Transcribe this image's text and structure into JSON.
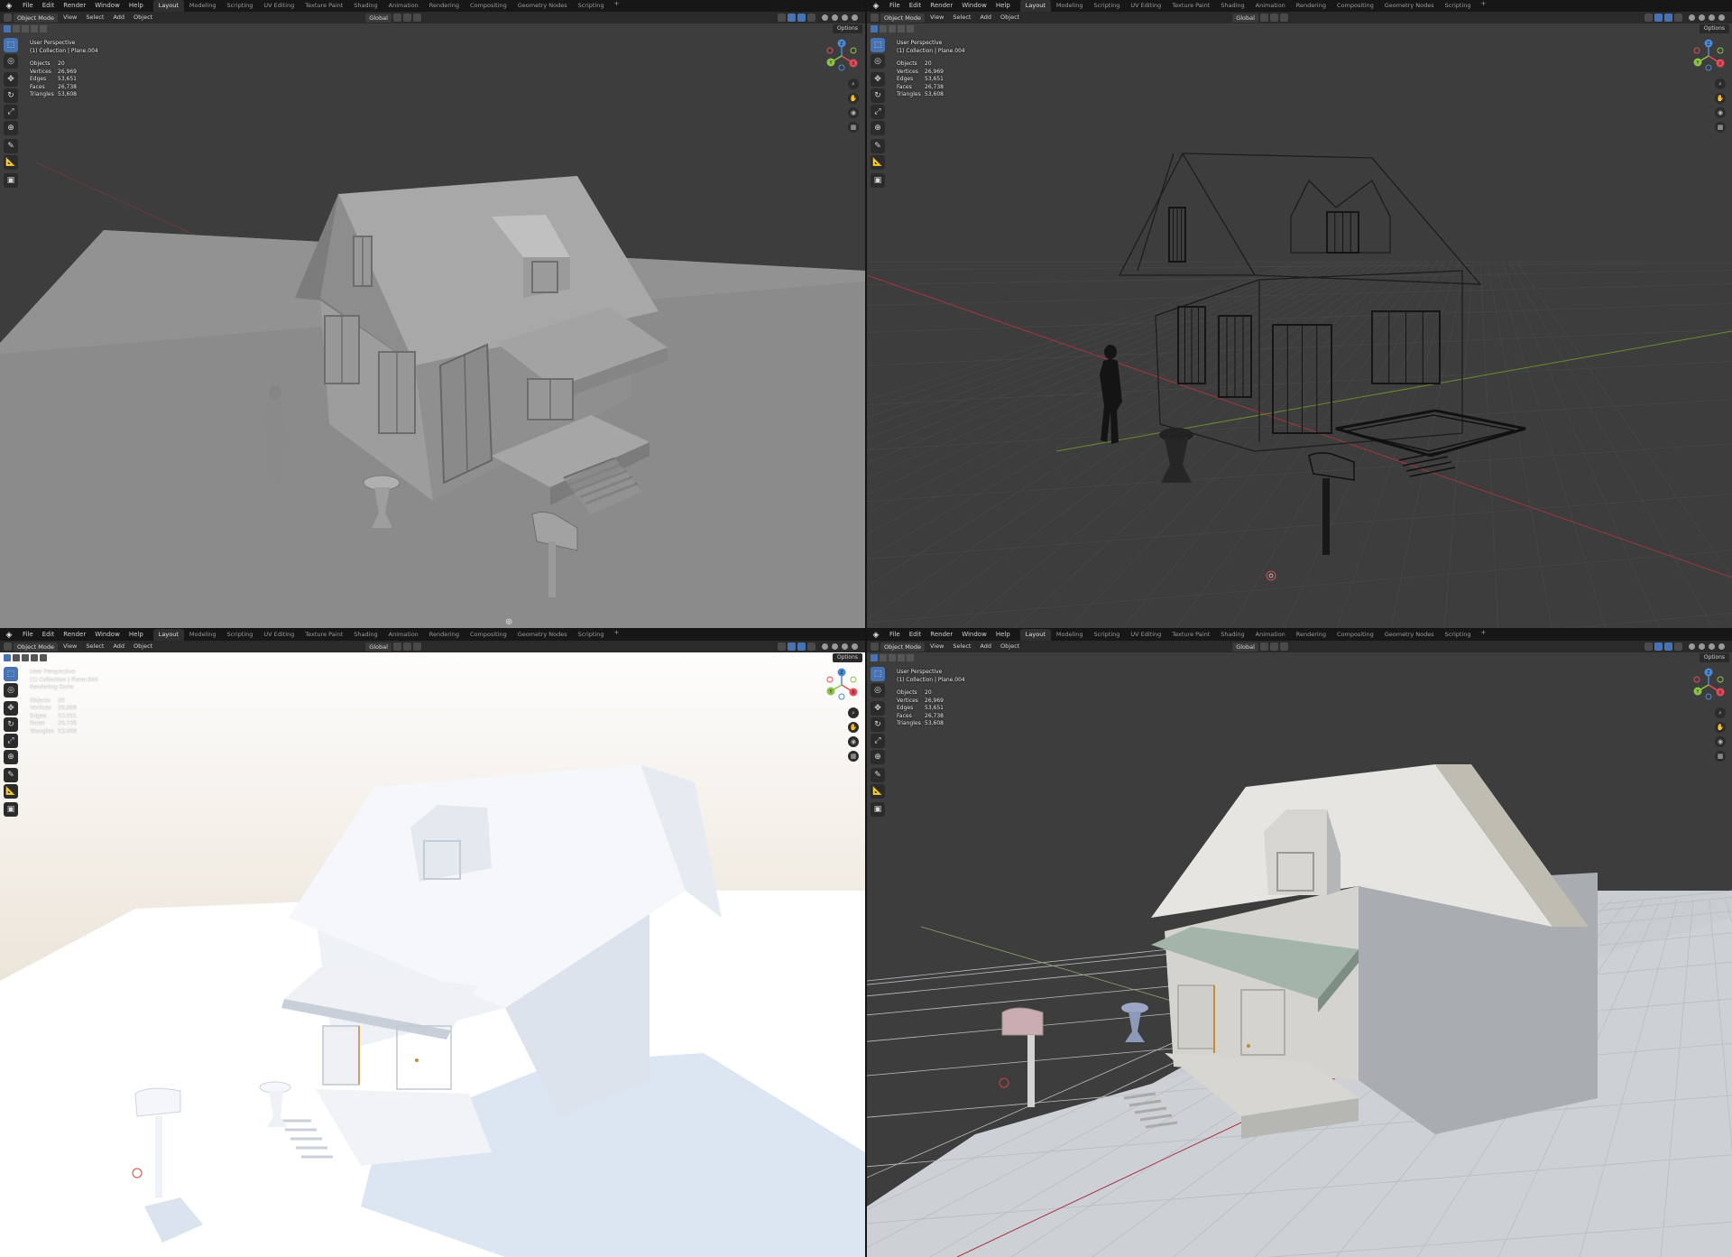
{
  "menus": [
    "File",
    "Edit",
    "Render",
    "Window",
    "Help"
  ],
  "workspaces": [
    "Layout",
    "Modeling",
    "Scripting",
    "UV Editing",
    "Texture Paint",
    "Shading",
    "Animation",
    "Rendering",
    "Compositing",
    "Geometry Nodes",
    "Scripting"
  ],
  "active_workspace_index": 0,
  "add_workspace": "+",
  "header": {
    "mode": "Object Mode",
    "menus": [
      "View",
      "Select",
      "Add",
      "Object"
    ],
    "orientation": "Global",
    "options": "Options"
  },
  "viewports": [
    {
      "view": "User Perspective",
      "collection": "(1) Collection | Plane.004",
      "note": "",
      "shading": "solid",
      "stats": [
        {
          "k": "Objects",
          "v": "20"
        },
        {
          "k": "Vertices",
          "v": "26,969"
        },
        {
          "k": "Edges",
          "v": "53,651"
        },
        {
          "k": "Faces",
          "v": "26,738"
        },
        {
          "k": "Triangles",
          "v": "53,608"
        }
      ]
    },
    {
      "view": "User Perspective",
      "collection": "(1) Collection | Plane.004",
      "note": "",
      "shading": "wireframe",
      "stats": [
        {
          "k": "Objects",
          "v": "20"
        },
        {
          "k": "Vertices",
          "v": "26,969"
        },
        {
          "k": "Edges",
          "v": "53,651"
        },
        {
          "k": "Faces",
          "v": "26,738"
        },
        {
          "k": "Triangles",
          "v": "53,608"
        }
      ]
    },
    {
      "view": "User Perspective",
      "collection": "(1) Collection | Plane.004",
      "note": "Rendering Done",
      "shading": "rendered",
      "stats": [
        {
          "k": "Objects",
          "v": "20"
        },
        {
          "k": "Vertices",
          "v": "26,969"
        },
        {
          "k": "Edges",
          "v": "53,651"
        },
        {
          "k": "Faces",
          "v": "26,738"
        },
        {
          "k": "Triangles",
          "v": "53,608"
        }
      ]
    },
    {
      "view": "User Perspective",
      "collection": "(1) Collection | Plane.004",
      "note": "",
      "shading": "material",
      "stats": [
        {
          "k": "Objects",
          "v": "20"
        },
        {
          "k": "Vertices",
          "v": "26,969"
        },
        {
          "k": "Edges",
          "v": "53,651"
        },
        {
          "k": "Faces",
          "v": "26,738"
        },
        {
          "k": "Triangles",
          "v": "53,608"
        }
      ]
    }
  ],
  "tools": [
    "select-box",
    "cursor",
    "move",
    "rotate",
    "scale",
    "transform",
    "annotate",
    "measure",
    "add-cube"
  ],
  "tool_glyphs": [
    "⬚",
    "◎",
    "✥",
    "↻",
    "⤢",
    "⊕",
    "✎",
    "📐",
    "▣"
  ],
  "gizmo": {
    "x": "X",
    "y": "Y",
    "z": "Z"
  },
  "colors": {
    "accent": "#4772b3",
    "axis_x": "#e44b5a",
    "axis_y": "#8bc34a",
    "axis_z": "#4a8ad8",
    "viewport_bg": "#3d3d3d"
  },
  "nav_icons": [
    "zoom-icon",
    "pan-hand-icon",
    "camera-icon",
    "grid-toggle-icon"
  ]
}
